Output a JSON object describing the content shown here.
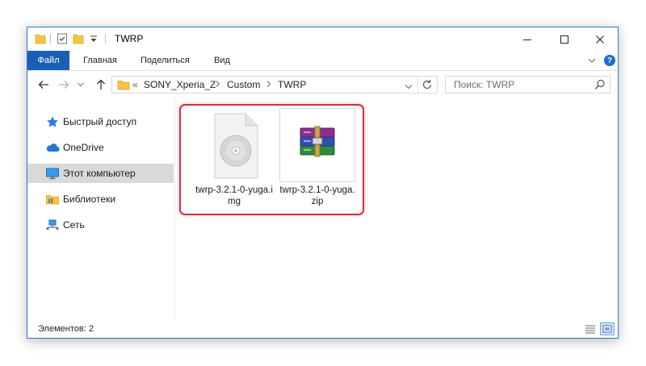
{
  "window": {
    "title": "TWRP",
    "accent": "#1a5fb4"
  },
  "window_controls": {
    "minimize_icon": "minimize-icon",
    "maximize_icon": "maximize-icon",
    "close_icon": "close-icon"
  },
  "ribbon": {
    "file_tab": "Файл",
    "tabs": [
      "Главная",
      "Поделиться",
      "Вид"
    ],
    "help_label": "?"
  },
  "address": {
    "overflow": "«",
    "crumbs": [
      "SONY_Xperia_Z",
      "Custom",
      "TWRP"
    ]
  },
  "search": {
    "placeholder": "Поиск: TWRP"
  },
  "sidebar": {
    "items": [
      {
        "label": "Быстрый доступ",
        "icon": "star-icon",
        "selected": false
      },
      {
        "label": "OneDrive",
        "icon": "cloud-icon",
        "selected": false
      },
      {
        "label": "Этот компьютер",
        "icon": "monitor-icon",
        "selected": true
      },
      {
        "label": "Библиотеки",
        "icon": "library-icon",
        "selected": false
      },
      {
        "label": "Сеть",
        "icon": "network-icon",
        "selected": false
      }
    ]
  },
  "files": [
    {
      "name": "twrp-3.2.1-0-yuga.img",
      "icon": "disc-image-file-icon"
    },
    {
      "name": "twrp-3.2.1-0-yuga.zip",
      "icon": "winrar-archive-icon"
    }
  ],
  "status": {
    "items_count": "Элементов: 2"
  },
  "colors": {
    "highlight": "#d2303c",
    "selected_nav": "#d9d9d9"
  }
}
